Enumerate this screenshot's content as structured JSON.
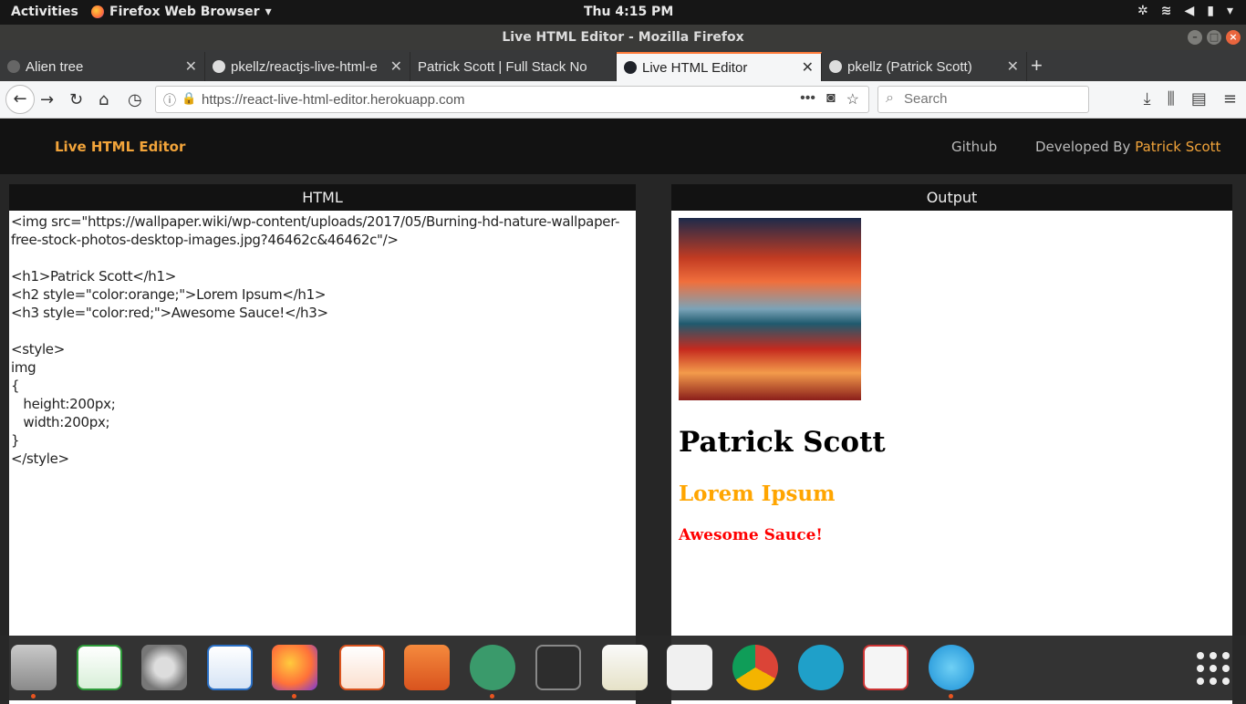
{
  "topbar": {
    "activities": "Activities",
    "app_name": "Firefox Web Browser",
    "clock": "Thu  4:15 PM"
  },
  "window": {
    "title": "Live HTML Editor - Mozilla Firefox"
  },
  "tabs": [
    {
      "label": "Alien tree"
    },
    {
      "label": "pkellz/reactjs-live-html-e"
    },
    {
      "label": "Patrick Scott | Full Stack No"
    },
    {
      "label": "Live HTML Editor"
    },
    {
      "label": "pkellz (Patrick Scott)"
    }
  ],
  "navbar": {
    "url": "https://react-live-html-editor.herokuapp.com",
    "search_placeholder": "Search"
  },
  "app": {
    "brand": "Live HTML Editor",
    "nav_github": "Github",
    "nav_developed_by": "Developed By",
    "nav_author": "Patrick Scott"
  },
  "editor": {
    "header": "HTML",
    "code": "<img src=\"https://wallpaper.wiki/wp-content/uploads/2017/05/Burning-hd-nature-wallpaper-free-stock-photos-desktop-images.jpg?46462c&46462c\"/>\n\n<h1>Patrick Scott</h1>\n<h2 style=\"color:orange;\">Lorem Ipsum</h1>\n<h3 style=\"color:red;\">Awesome Sauce!</h3>\n\n<style>\nimg\n{\n   height:200px;\n   width:200px;\n}\n</style>"
  },
  "output": {
    "header": "Output",
    "h1": "Patrick Scott",
    "h2": "Lorem Ipsum",
    "h3": "Awesome Sauce!"
  },
  "colors": {
    "accent": "#f2a43a",
    "tab_active_border": "#ff7b3a",
    "orange": "#ffa500",
    "red": "#ff0000"
  }
}
